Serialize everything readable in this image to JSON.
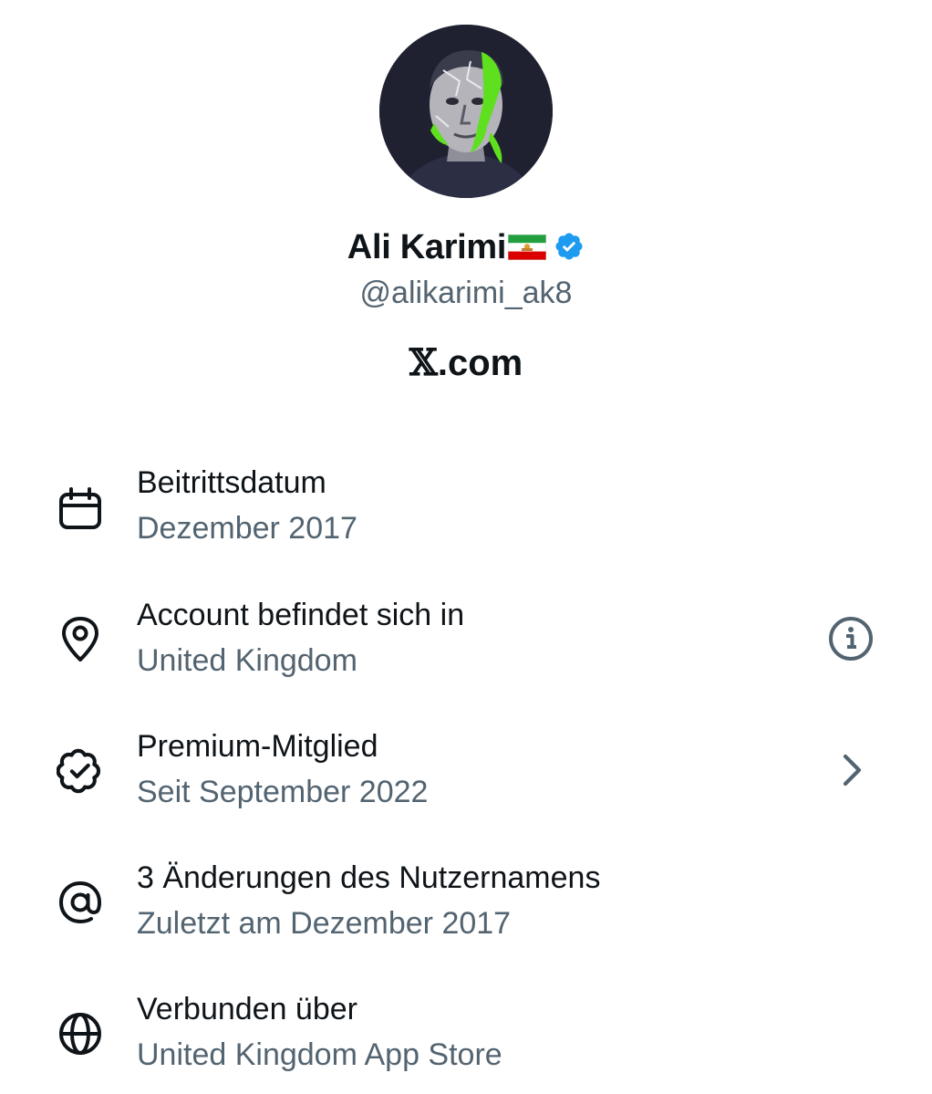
{
  "profile": {
    "display_name": "Ali Karimi",
    "flag_icon": "lion-and-sun-flag-icon",
    "verified_icon": "verified-badge-icon",
    "verified_color": "#1d9bf0",
    "handle": "@alikarimi_ak8",
    "domain_x": "𝕏",
    "domain_rest": ".com"
  },
  "about": [
    {
      "icon": "calendar-icon",
      "title": "Beitrittsdatum",
      "subtitle": "Dezember 2017"
    },
    {
      "icon": "location-pin-icon",
      "title": "Account befindet sich in",
      "subtitle": "United Kingdom",
      "action_icon": "info-icon"
    },
    {
      "icon": "verified-outline-icon",
      "title": "Premium-Mitglied",
      "subtitle": "Seit September 2022",
      "action_icon": "chevron-right-icon"
    },
    {
      "icon": "at-sign-icon",
      "title": "3 Änderungen des Nutzernamens",
      "subtitle": "Zuletzt am Dezember 2017"
    },
    {
      "icon": "globe-icon",
      "title": "Verbunden über",
      "subtitle": "United Kingdom App Store"
    }
  ],
  "colors": {
    "primary_text": "#0f1419",
    "secondary_text": "#536471",
    "avatar_accent": "#5fe01e"
  }
}
